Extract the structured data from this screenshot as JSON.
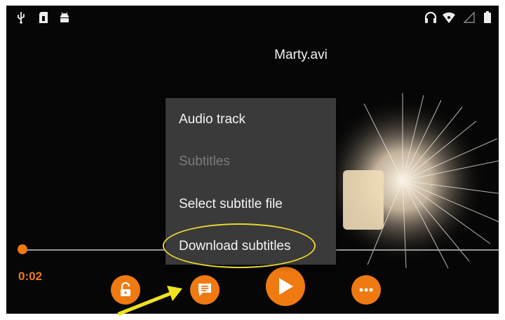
{
  "status_bar": {
    "left_icons": [
      "usb-icon",
      "sd-card-icon",
      "android-icon"
    ],
    "right_icons": [
      "headset-icon",
      "wifi-icon",
      "signal-icon",
      "battery-icon"
    ]
  },
  "video": {
    "title": "Marty.avi"
  },
  "playback": {
    "current_time": "0:02",
    "progress": 0.005
  },
  "controls": [
    "lock-icon",
    "subtitles-icon",
    "play-icon",
    "more-options-icon"
  ],
  "menu": {
    "items": [
      {
        "label": "Audio track",
        "enabled": true
      },
      {
        "label": "Subtitles",
        "enabled": false
      },
      {
        "label": "Select subtitle file",
        "enabled": true
      },
      {
        "label": "Download subtitles",
        "enabled": true
      }
    ]
  },
  "colors": {
    "accent": "#f07a12",
    "highlight": "#e8d534",
    "menu_bg": "#3a3a3a",
    "background": "#060606"
  }
}
